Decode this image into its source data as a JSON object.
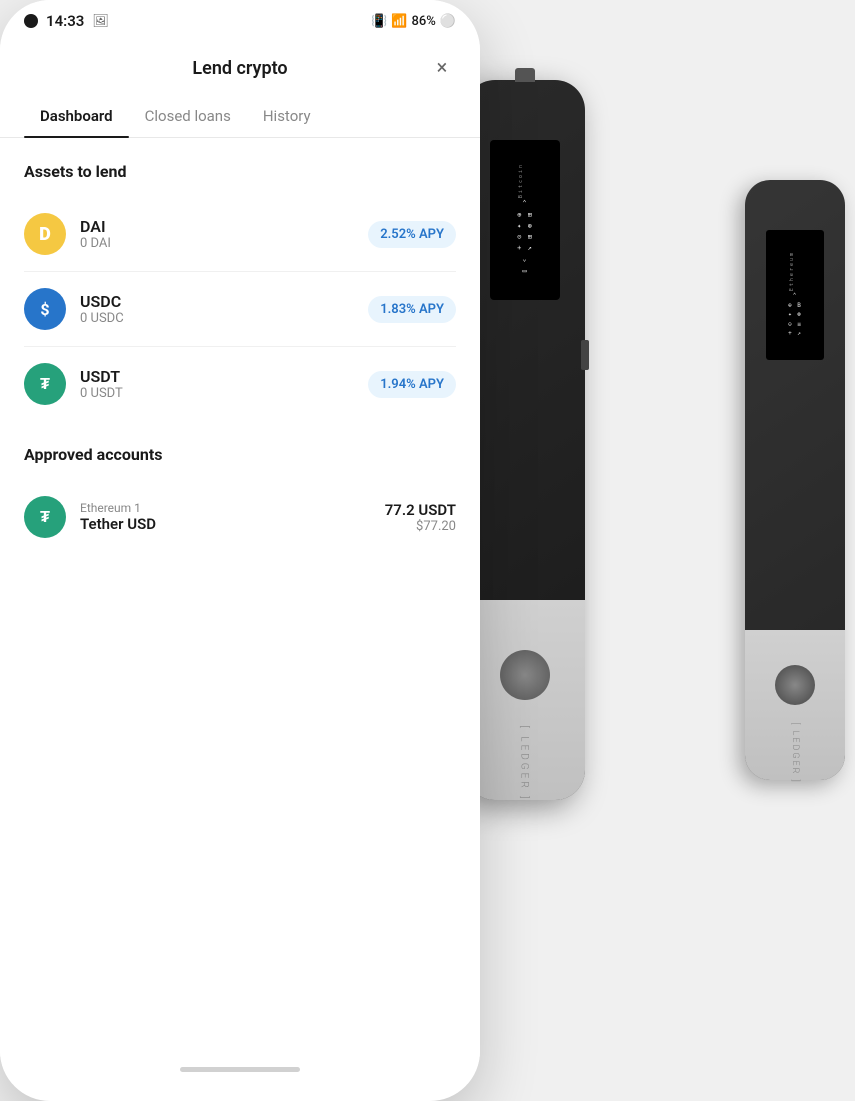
{
  "statusBar": {
    "time": "14:33",
    "battery": "86%"
  },
  "modal": {
    "title": "Lend crypto",
    "close_label": "×"
  },
  "tabs": [
    {
      "id": "dashboard",
      "label": "Dashboard",
      "active": true
    },
    {
      "id": "closed-loans",
      "label": "Closed loans",
      "active": false
    },
    {
      "id": "history",
      "label": "History",
      "active": false
    }
  ],
  "assetsSection": {
    "title": "Assets to lend",
    "assets": [
      {
        "id": "dai",
        "name": "DAI",
        "balance": "0 DAI",
        "apy": "2.52% APY",
        "iconBg": "#f5c842",
        "iconText": "D"
      },
      {
        "id": "usdc",
        "name": "USDC",
        "balance": "0 USDC",
        "apy": "1.83% APY",
        "iconBg": "#2775ca",
        "iconText": "$"
      },
      {
        "id": "usdt",
        "name": "USDT",
        "balance": "0 USDT",
        "apy": "1.94% APY",
        "iconBg": "#26a17b",
        "iconText": "₮"
      }
    ]
  },
  "approvedSection": {
    "title": "Approved accounts",
    "accounts": [
      {
        "id": "eth1-usdt",
        "subLabel": "Ethereum 1",
        "name": "Tether USD",
        "amount": "77.2 USDT",
        "fiat": "$77.20",
        "iconBg": "#26a17b",
        "iconText": "₮"
      }
    ]
  },
  "ledgerMain": {
    "screenLines": [
      "⌃",
      "⊕ ⊞",
      "⊗ ✦",
      "⊝ ⊛",
      "+ ↗",
      "⌄",
      "▭"
    ],
    "textLabel": "[ LEDGER ]",
    "screenTitle": "Bitcoin"
  },
  "ledgerSecondary": {
    "screenLines": [
      "⌃",
      "⊞ B",
      "⊗ ⊛",
      "⊝ ≡",
      "+ ↗"
    ],
    "textLabel": "[ LEDGER ]",
    "screenTitle": "Ethereum"
  }
}
